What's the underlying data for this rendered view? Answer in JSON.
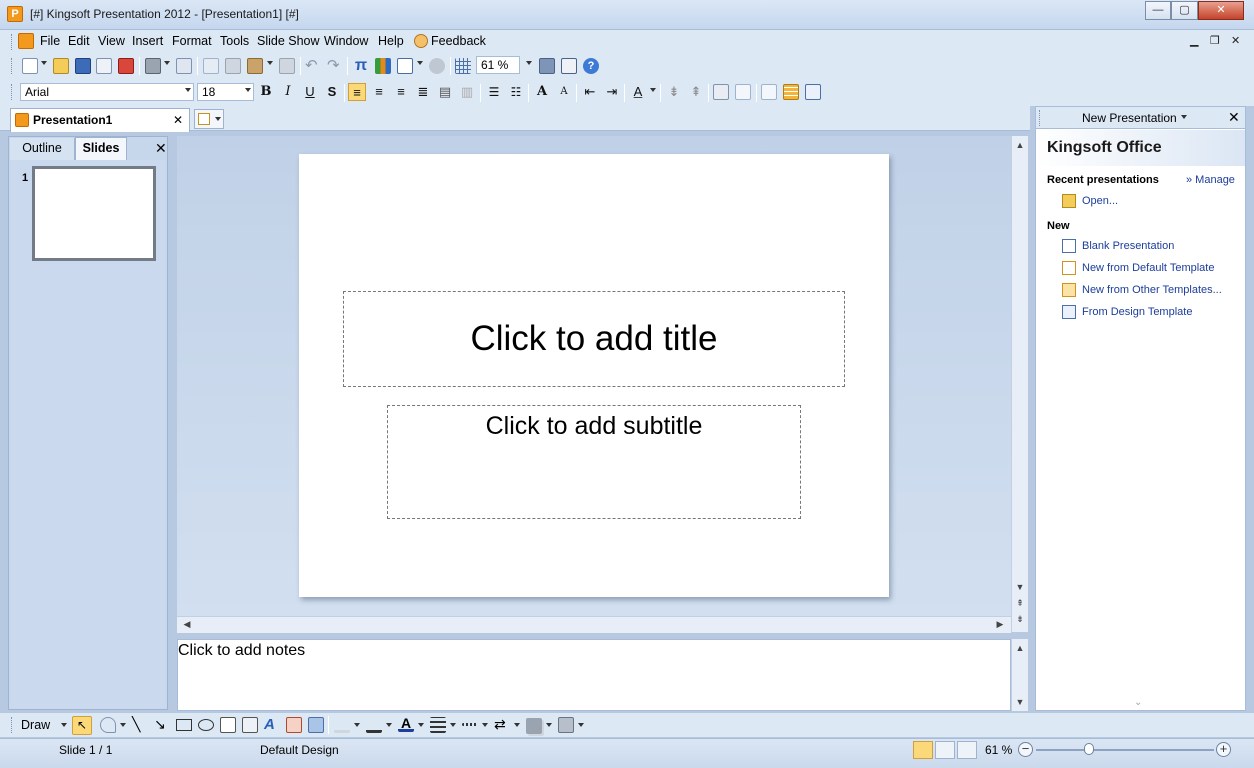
{
  "window": {
    "title": "[#] Kingsoft Presentation 2012 - [Presentation1] [#]",
    "minimize": "—",
    "maximize": "▢",
    "close": "✕"
  },
  "menu": {
    "items": [
      "File",
      "Edit",
      "View",
      "Insert",
      "Format",
      "Tools",
      "Slide Show",
      "Window",
      "Help",
      "Feedback"
    ],
    "doc_minimize": "▁",
    "doc_restore": "❐",
    "doc_close": "✕"
  },
  "standard_toolbar": {
    "zoom_value": "61 %",
    "icons": [
      "new-icon",
      "open-icon",
      "save-icon",
      "email-icon",
      "pdf-icon",
      "print-icon",
      "print-preview-icon",
      "copy-icon",
      "cut-icon",
      "paste-icon",
      "format-painter-icon",
      "undo-icon",
      "redo-icon",
      "equation-icon",
      "chart-icon",
      "table-icon",
      "grid-icon",
      "find-icon",
      "home-icon",
      "help-icon"
    ]
  },
  "formatting_toolbar": {
    "font_name": "Arial",
    "font_size": "18",
    "bold": "B",
    "italic": "I",
    "underline": "U",
    "shadow": "S"
  },
  "document_tabs": {
    "active": "Presentation1",
    "close": "✕"
  },
  "left_pane": {
    "tabs": [
      "Outline",
      "Slides"
    ],
    "active_tab": "Slides",
    "close": "✕",
    "slide_numbers": [
      "1"
    ]
  },
  "slide": {
    "title_placeholder": "Click to add title",
    "subtitle_placeholder": "Click to add subtitle"
  },
  "notes": {
    "placeholder": "Click to add notes"
  },
  "task_pane": {
    "header": "New Presentation",
    "close": "✕",
    "brand": "Kingsoft Office",
    "recent_heading": "Recent presentations",
    "manage_link": "» Manage",
    "open_link": "Open...",
    "new_heading": "New",
    "new_links": [
      "Blank Presentation",
      "New from Default Template",
      "New from Other Templates...",
      "From Design Template"
    ]
  },
  "draw_toolbar": {
    "draw_label": "Draw"
  },
  "status_bar": {
    "slide_position": "Slide 1 / 1",
    "design": "Default Design",
    "zoom": "61 %",
    "zoom_out": "−",
    "zoom_in": "+",
    "zoom_level": 0.3
  },
  "colors": {
    "chrome": "#dde8f5",
    "accent": "#f39a1e",
    "link": "#1d3e9a"
  }
}
